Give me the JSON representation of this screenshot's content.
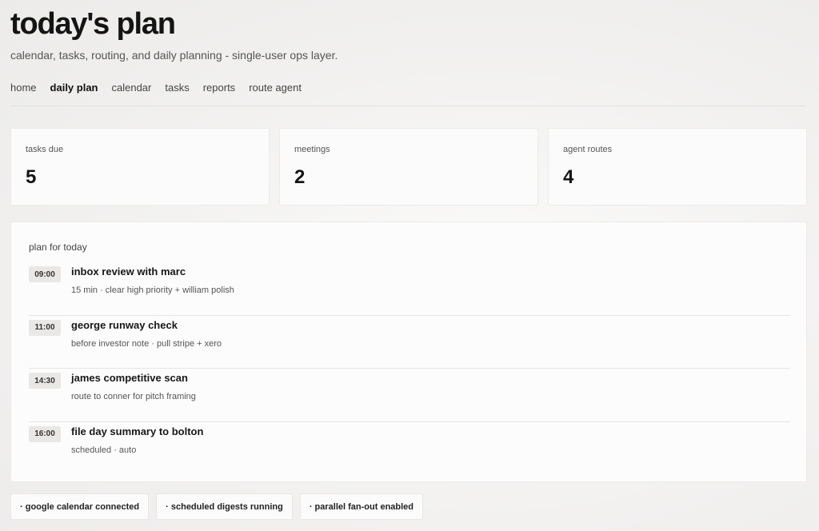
{
  "header": {
    "title": "today's plan",
    "subtitle": "calendar, tasks, routing, and daily planning - single-user ops layer."
  },
  "nav": {
    "items": [
      {
        "label": "home",
        "active": false
      },
      {
        "label": "daily plan",
        "active": true
      },
      {
        "label": "calendar",
        "active": false
      },
      {
        "label": "tasks",
        "active": false
      },
      {
        "label": "reports",
        "active": false
      },
      {
        "label": "route agent",
        "active": false
      }
    ]
  },
  "stats": [
    {
      "label": "tasks due",
      "value": "5"
    },
    {
      "label": "meetings",
      "value": "2"
    },
    {
      "label": "agent routes",
      "value": "4"
    }
  ],
  "plan": {
    "title": "plan for today",
    "items": [
      {
        "time": "09:00",
        "title": "inbox review with marc",
        "detail": "15 min · clear high priority + william polish"
      },
      {
        "time": "11:00",
        "title": "george runway check",
        "detail": "before investor note · pull stripe + xero"
      },
      {
        "time": "14:30",
        "title": "james competitive scan",
        "detail": "route to conner for pitch framing"
      },
      {
        "time": "16:00",
        "title": "file day summary to bolton",
        "detail": "scheduled · auto"
      }
    ]
  },
  "status_chips": [
    "· google calendar connected",
    "· scheduled digests running",
    "· parallel fan-out enabled"
  ]
}
